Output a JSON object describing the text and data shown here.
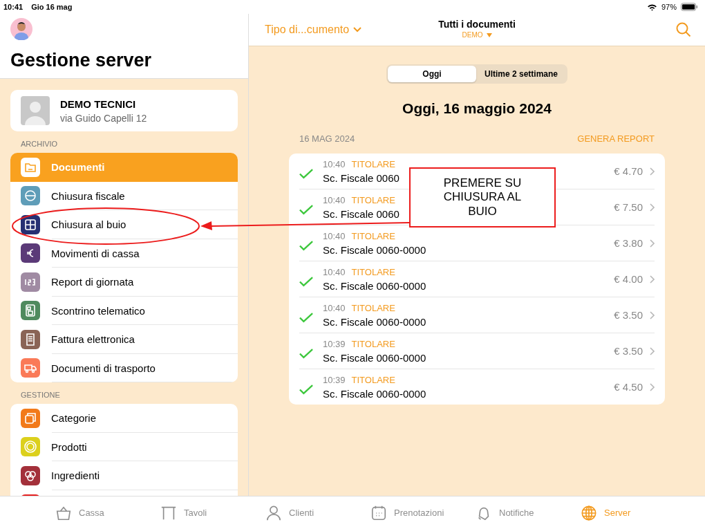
{
  "status_bar": {
    "time": "10:41",
    "date": "Gio 16 mag",
    "battery": "97%"
  },
  "sidebar": {
    "title": "Gestione server",
    "profile": {
      "name": "DEMO TECNICI",
      "address": "via Guido Capelli 12"
    },
    "sections": [
      {
        "header": "ARCHIVIO",
        "items": [
          {
            "label": "Documenti",
            "color": "#f9a11f",
            "selected": true
          },
          {
            "label": "Chiusura fiscale",
            "color": "#5f9db8",
            "selected": false
          },
          {
            "label": "Chiusura al buio",
            "color": "#263073",
            "selected": false
          },
          {
            "label": "Movimenti di cassa",
            "color": "#5b3a78",
            "selected": false
          },
          {
            "label": "Report di giornata",
            "color": "#a08ba3",
            "selected": false
          },
          {
            "label": "Scontrino telematico",
            "color": "#4f8a5e",
            "selected": false
          },
          {
            "label": "Fattura elettronica",
            "color": "#8a6456",
            "selected": false
          },
          {
            "label": "Documenti di trasporto",
            "color": "#fa7a58",
            "selected": false
          }
        ]
      },
      {
        "header": "GESTIONE",
        "items": [
          {
            "label": "Categorie",
            "color": "#f27a1a",
            "selected": false
          },
          {
            "label": "Prodotti",
            "color": "#dcd01c",
            "selected": false
          },
          {
            "label": "Ingredienti",
            "color": "#a3303a",
            "selected": false
          }
        ]
      }
    ]
  },
  "nav": {
    "filter": "Tipo di...cumento",
    "title": "Tutti i documenti",
    "subtitle": "DEMO"
  },
  "segments": [
    {
      "label": "Oggi",
      "selected": true
    },
    {
      "label": "Ultime 2 settimane",
      "selected": false
    }
  ],
  "heading": "Oggi, 16 maggio 2024",
  "section": {
    "date": "16 MAG 2024",
    "action": "GENERA REPORT"
  },
  "documents": [
    {
      "time": "10:40",
      "role": "TITOLARE",
      "name": "Sc. Fiscale 0060",
      "amount": "€ 4.70",
      "done": true
    },
    {
      "time": "10:40",
      "role": "TITOLARE",
      "name": "Sc. Fiscale 0060",
      "amount": "€ 7.50",
      "done": true
    },
    {
      "time": "10:40",
      "role": "TITOLARE",
      "name": "Sc. Fiscale 0060-0000",
      "amount": "€ 3.80",
      "done": true
    },
    {
      "time": "10:40",
      "role": "TITOLARE",
      "name": "Sc. Fiscale 0060-0000",
      "amount": "€ 4.00",
      "done": true
    },
    {
      "time": "10:40",
      "role": "TITOLARE",
      "name": "Sc. Fiscale 0060-0000",
      "amount": "€ 3.50",
      "done": true
    },
    {
      "time": "10:39",
      "role": "TITOLARE",
      "name": "Sc. Fiscale 0060-0000",
      "amount": "€ 3.50",
      "done": true
    },
    {
      "time": "10:39",
      "role": "TITOLARE",
      "name": "Sc. Fiscale 0060-0000",
      "amount": "€ 4.50",
      "done": true
    }
  ],
  "annotation": {
    "text": "PREMERE SU CHIUSURA AL BUIO"
  },
  "tab_bar": [
    {
      "label": "Cassa",
      "selected": false
    },
    {
      "label": "Tavoli",
      "selected": false
    },
    {
      "label": "Clienti",
      "selected": false
    },
    {
      "label": "Prenotazioni",
      "selected": false
    },
    {
      "label": "Notifiche",
      "selected": false
    },
    {
      "label": "Server",
      "selected": true
    }
  ]
}
